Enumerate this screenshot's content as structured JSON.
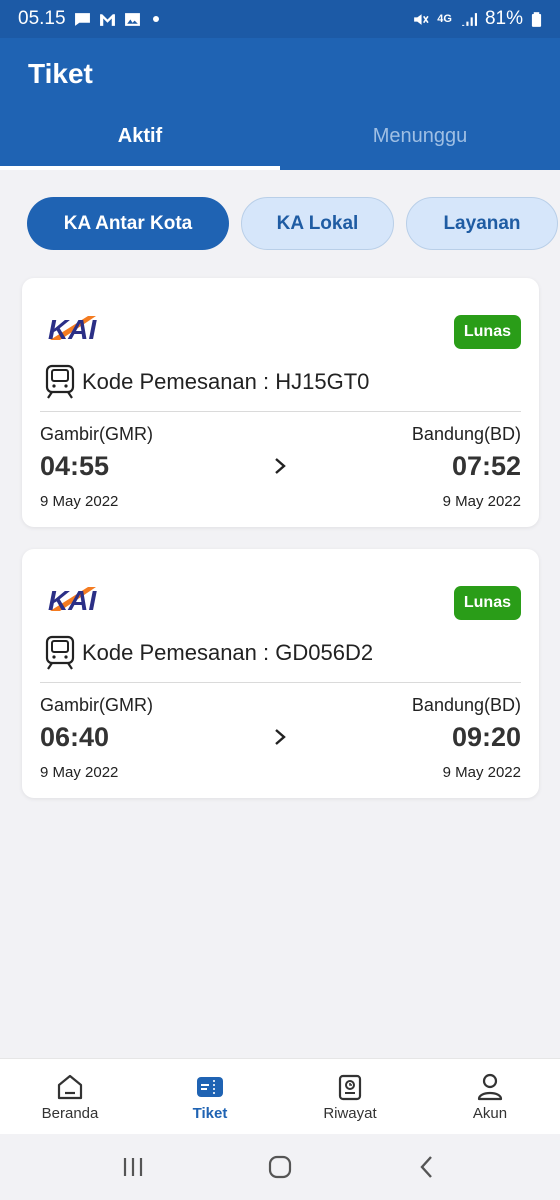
{
  "status_bar": {
    "time": "05.15",
    "network": "4G",
    "battery": "81%"
  },
  "header": {
    "title": "Tiket",
    "tabs": [
      {
        "label": "Aktif",
        "active": true
      },
      {
        "label": "Menunggu",
        "active": false
      }
    ]
  },
  "filters": [
    {
      "label": "KA Antar Kota",
      "active": true
    },
    {
      "label": "KA Lokal",
      "active": false
    },
    {
      "label": "Layanan",
      "active": false
    }
  ],
  "tickets": [
    {
      "logo_text": "KAI",
      "status": "Lunas",
      "code_label": "Kode Pemesanan : ",
      "code": "HJ15GT0",
      "origin": "Gambir(GMR)",
      "destination": "Bandung(BD)",
      "depart_time": "04:55",
      "arrive_time": "07:52",
      "depart_date": "9 May 2022",
      "arrive_date": "9 May 2022"
    },
    {
      "logo_text": "KAI",
      "status": "Lunas",
      "code_label": "Kode Pemesanan : ",
      "code": "GD056D2",
      "origin": "Gambir(GMR)",
      "destination": "Bandung(BD)",
      "depart_time": "06:40",
      "arrive_time": "09:20",
      "depart_date": "9 May 2022",
      "arrive_date": "9 May 2022"
    }
  ],
  "bottom_nav": [
    {
      "label": "Beranda",
      "icon": "home-icon",
      "active": false
    },
    {
      "label": "Tiket",
      "icon": "ticket-icon",
      "active": true
    },
    {
      "label": "Riwayat",
      "icon": "history-icon",
      "active": false
    },
    {
      "label": "Akun",
      "icon": "user-icon",
      "active": false
    }
  ],
  "colors": {
    "primary": "#1f63b3",
    "status_bar": "#1c5aa6",
    "paid_badge": "#2a9d18",
    "chip_inactive": "#d6e6fa"
  }
}
